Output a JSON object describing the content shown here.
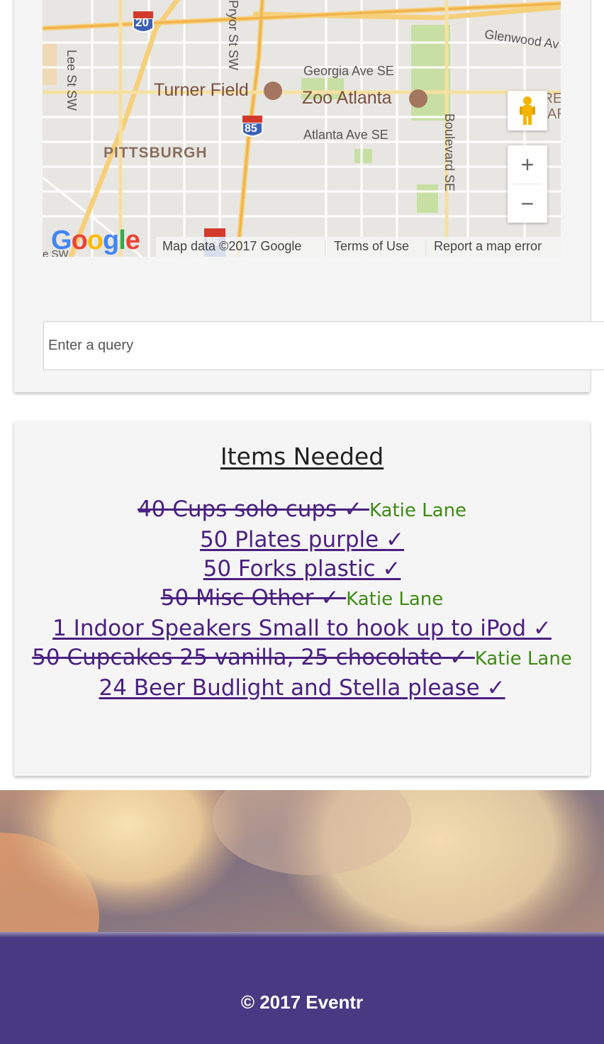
{
  "map": {
    "labels": {
      "interstate_20": "20",
      "interstate_85_top": "85",
      "interstate_85_bottom": "85",
      "pryor_st": "Pryor St SW",
      "lee_st": "Lee St SW",
      "glenwood": "Glenwood Av",
      "georgia_ave": "Georgia Ave SE",
      "turner_field": "Turner Field",
      "zoo_atlanta": "Zoo Atlanta",
      "atlanta_ave": "Atlanta Ave SE",
      "pittsburgh": "PITTSBURGH",
      "boulevard": "Boulevard SE",
      "partial_right_1": "GRE EW",
      "partial_right_2": "AR",
      "partial_bottom_left": "e SW"
    },
    "google_logo": [
      "G",
      "o",
      "o",
      "g",
      "l",
      "e"
    ],
    "footer": {
      "map_data": "Map data ©2017 Google",
      "terms": "Terms of Use",
      "report": "Report a map error"
    },
    "zoom_in": "+",
    "zoom_out": "−"
  },
  "search": {
    "placeholder": "Enter a query",
    "value": ""
  },
  "items_needed": {
    "title": "Items Needed",
    "items": [
      {
        "text": "40 Cups solo cups ✓ ",
        "claimed_by": "Katie Lane",
        "done": true
      },
      {
        "text": "50 Plates purple ✓",
        "claimed_by": "",
        "done": false
      },
      {
        "text": "50 Forks plastic ✓",
        "claimed_by": "",
        "done": false
      },
      {
        "text": "50 Misc Other ✓ ",
        "claimed_by": "Katie Lane",
        "done": true
      },
      {
        "text": "1 Indoor Speakers Small to hook up to iPod ✓",
        "claimed_by": "",
        "done": false
      },
      {
        "text": "50 Cupcakes 25 vanilla, 25 chocolate ✓ ",
        "claimed_by": "Katie Lane",
        "done": true
      },
      {
        "text": "24 Beer Budlight and Stella please ✓",
        "claimed_by": "",
        "done": false
      }
    ]
  },
  "footer": {
    "copyright": "© 2017 Eventr"
  },
  "colors": {
    "item_link": "#4b2080",
    "claimer": "#3f8a14",
    "footer_bg": "#473a82",
    "card_bg": "#f5f5f5"
  }
}
